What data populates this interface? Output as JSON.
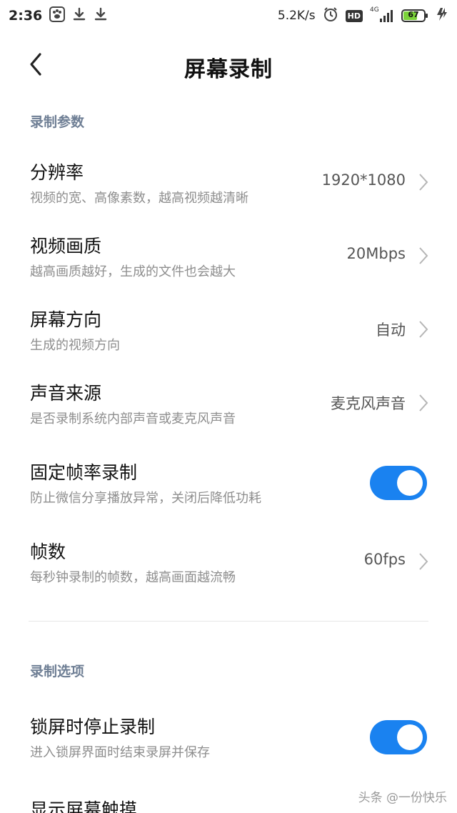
{
  "status_bar": {
    "time": "2:36",
    "network_speed": "5.2K/s",
    "hd_label": "HD",
    "signal_label": "4G",
    "battery": "67",
    "icons": [
      "baidu-paw-icon",
      "download-icon",
      "download-icon",
      "alarm-icon",
      "hd-icon",
      "signal-icon",
      "battery-icon",
      "charging-icon"
    ]
  },
  "header": {
    "title": "屏幕录制",
    "back_icon": "chevron-left-icon"
  },
  "sections": [
    {
      "title": "录制参数",
      "items": [
        {
          "title": "分辨率",
          "subtitle": "视频的宽、高像素数，越高视频越清晰",
          "value": "1920*1080"
        },
        {
          "title": "视频画质",
          "subtitle": "越高画质越好，生成的文件也会越大",
          "value": "20Mbps"
        },
        {
          "title": "屏幕方向",
          "subtitle": "生成的视频方向",
          "value": "自动"
        },
        {
          "title": "声音来源",
          "subtitle": "是否录制系统内部声音或麦克风声音",
          "value": "麦克风声音"
        },
        {
          "title": "固定帧率录制",
          "subtitle": "防止微信分享播放异常，关闭后降低功耗",
          "toggle": true
        },
        {
          "title": "帧数",
          "subtitle": "每秒钟录制的帧数，越高画面越流畅",
          "value": "60fps"
        }
      ]
    },
    {
      "title": "录制选项",
      "items": [
        {
          "title": "锁屏时停止录制",
          "subtitle": "进入锁屏界面时结束录屏并保存",
          "toggle": true
        },
        {
          "title": "显示屏幕触摸",
          "subtitle": ""
        }
      ]
    }
  ],
  "colors": {
    "accent": "#1a82f0",
    "section_title": "#6f7f95",
    "subtitle": "#8e8e8e"
  },
  "watermark": "头条 @一份快乐"
}
